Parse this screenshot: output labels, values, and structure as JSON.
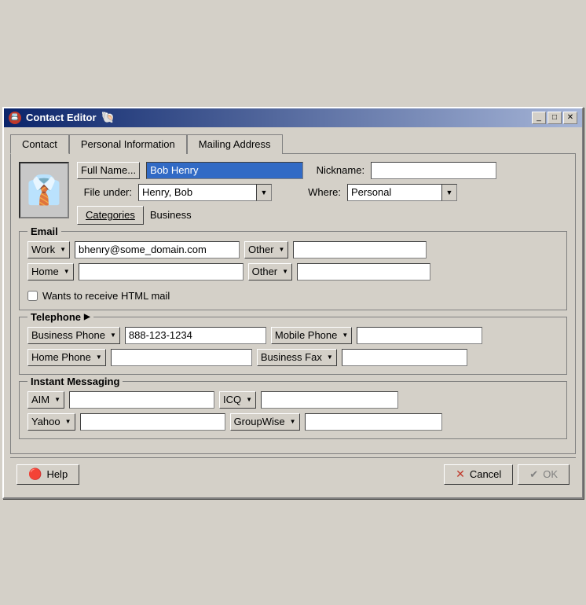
{
  "window": {
    "title": "Contact Editor",
    "titleIcon": "📇"
  },
  "tabs": [
    {
      "label": "Contact",
      "active": true
    },
    {
      "label": "Personal Information",
      "active": false
    },
    {
      "label": "Mailing Address",
      "active": false
    }
  ],
  "contact": {
    "fullNameLabel": "Full Name...",
    "fullNameValue": "Bob Henry",
    "nicknameLabel": "Nickname:",
    "nicknameValue": "",
    "fileUnderLabel": "File under:",
    "fileUnderValue": "Henry, Bob",
    "whereLabel": "Where:",
    "whereValue": "Personal",
    "categoriesLabel": "Categories",
    "categoriesValue": "Business"
  },
  "email": {
    "sectionTitle": "Email",
    "row1": {
      "type": "Work",
      "value": "bhenry@some_domain.com",
      "type2": "Other",
      "value2": ""
    },
    "row2": {
      "type": "Home",
      "value": "",
      "type2": "Other",
      "value2": ""
    },
    "htmlMailLabel": "Wants to receive HTML mail"
  },
  "telephone": {
    "sectionTitle": "Telephone",
    "row1": {
      "type": "Business Phone",
      "value": "888-123-1234",
      "type2": "Mobile Phone",
      "value2": ""
    },
    "row2": {
      "type": "Home Phone",
      "value": "",
      "type2": "Business Fax",
      "value2": ""
    }
  },
  "im": {
    "sectionTitle": "Instant Messaging",
    "row1": {
      "type": "AIM",
      "value": "",
      "type2": "ICQ",
      "value2": ""
    },
    "row2": {
      "type": "Yahoo",
      "value": "",
      "type2": "GroupWise",
      "value2": ""
    }
  },
  "buttons": {
    "help": "Help",
    "cancel": "Cancel",
    "ok": "OK"
  }
}
